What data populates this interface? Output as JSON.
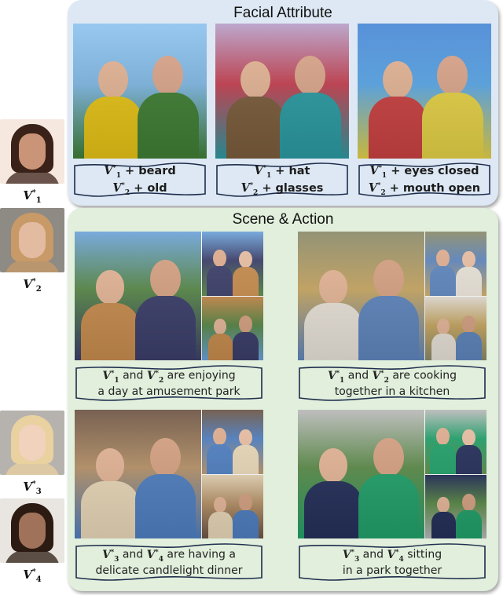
{
  "identities": [
    {
      "id": "V1",
      "label_base": "V",
      "label_sub": "1",
      "label_sup": "*",
      "description": "young man with dark hair",
      "colors": [
        "#f6e8df",
        "#3a2218",
        "#c99477"
      ]
    },
    {
      "id": "V2",
      "label_base": "V",
      "label_sub": "2",
      "label_sup": "*",
      "description": "young woman with long wavy blonde hair",
      "colors": [
        "#8e8a84",
        "#c89a68",
        "#e3bba0"
      ]
    },
    {
      "id": "V3",
      "label_base": "V",
      "label_sub": "3",
      "label_sup": "*",
      "description": "young woman with platinum blonde hair",
      "colors": [
        "#b6b2ae",
        "#e9d1a0",
        "#f1d2bd"
      ]
    },
    {
      "id": "V4",
      "label_base": "V",
      "label_sub": "4",
      "label_sup": "*",
      "description": "man with dark curly hair and beard",
      "colors": [
        "#e9e5e0",
        "#2b1b12",
        "#a0725a"
      ]
    }
  ],
  "facial_panel": {
    "title": "Facial Attribute",
    "background": "#dde8f4",
    "items": [
      {
        "image_desc": "man with beard and old woman at amusement park",
        "lines": [
          {
            "v": "V",
            "sub": "1",
            "sup": "*",
            "text": " + beard"
          },
          {
            "v": "V",
            "sub": "2",
            "sup": "*",
            "text": " + old"
          }
        ],
        "colors": [
          "#7fb7e3",
          "#3f7d34",
          "#e4c117",
          "#8fc3ee"
        ]
      },
      {
        "image_desc": "woman with sunglasses and man with hat at amusement park",
        "lines": [
          {
            "v": "V",
            "sub": "1",
            "sup": "*",
            "text": " + hat"
          },
          {
            "v": "V",
            "sub": "2",
            "sup": "*",
            "text": " + glasses"
          }
        ],
        "colors": [
          "#c44050",
          "#2b9aa1",
          "#7a5c3c",
          "#b6a0c8"
        ]
      },
      {
        "image_desc": "woman with mouth open and man with eyes closed at amusement park",
        "lines": [
          {
            "v": "V",
            "sub": "1",
            "sup": "*",
            "text": " + eyes closed"
          },
          {
            "v": "V",
            "sub": "2",
            "sup": "*",
            "text": " + mouth open"
          }
        ],
        "colors": [
          "#5aa6e6",
          "#e3d046",
          "#c84141",
          "#4a88d6"
        ]
      }
    ]
  },
  "scene_panel": {
    "title": "Scene & Action",
    "background": "#e1efdc",
    "items": [
      {
        "image_desc": "couple at amusement park collage",
        "lines": [
          {
            "v1": "V",
            "sub1": "1",
            "sup1": "*",
            "mid": " and ",
            "v2": "V",
            "sub2": "2",
            "sup2": "*",
            "text": " are enjoying"
          },
          {
            "text": "a day at amusement park"
          }
        ],
        "colors": [
          "#5a8a4a",
          "#3c3f6a",
          "#c78c4e",
          "#6ea3d9"
        ]
      },
      {
        "image_desc": "couple cooking in kitchen collage",
        "lines": [
          {
            "v1": "V",
            "sub1": "1",
            "sup1": "*",
            "mid": " and ",
            "v2": "V",
            "sub2": "2",
            "sup2": "*",
            "text": " are cooking"
          },
          {
            "text": "together in a kitchen"
          }
        ],
        "colors": [
          "#c9a864",
          "#5f86bd",
          "#e8e2d8",
          "#8a8a6a"
        ]
      },
      {
        "image_desc": "couple having candlelight dinner collage",
        "lines": [
          {
            "v1": "V",
            "sub1": "3",
            "sup1": "*",
            "mid": " and ",
            "v2": "V",
            "sub2": "4",
            "sup2": "*",
            "text": " are having a"
          },
          {
            "text": "delicate candlelight dinner"
          }
        ],
        "colors": [
          "#b8946a",
          "#4f7fc0",
          "#e8d7b8",
          "#6c5444"
        ]
      },
      {
        "image_desc": "couple sitting in a park collage",
        "lines": [
          {
            "v1": "V",
            "sub1": "3",
            "sup1": "*",
            "mid": " and ",
            "v2": "V",
            "sub2": "4",
            "sup2": "*",
            "text": " sitting"
          },
          {
            "text": "in a park together"
          }
        ],
        "colors": [
          "#5d8c4a",
          "#22a06a",
          "#25305a",
          "#b9b9b9"
        ]
      }
    ]
  }
}
